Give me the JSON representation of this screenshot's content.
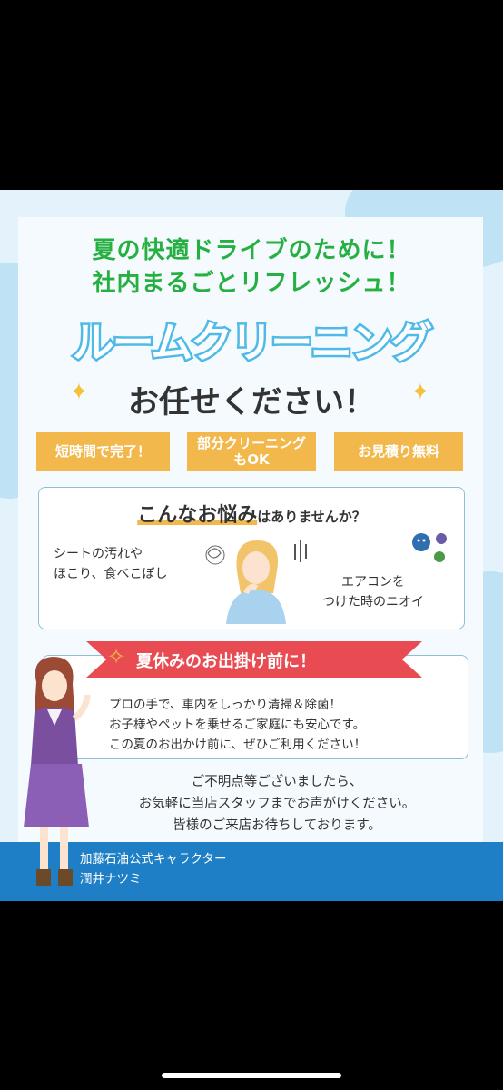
{
  "headline": {
    "line1": "夏の快適ドライブのために！",
    "line2": "社内まるごとリフレッシュ！"
  },
  "title": "ルームクリーニング",
  "subtitle": "お任せください！",
  "tags": [
    "短時間で完了！",
    "部分クリーニング\nもOK",
    "お見積り無料"
  ],
  "worry": {
    "heading_a": "こんなお悩み",
    "heading_b": "はありませんか？",
    "left_note": "シートの汚れや\nほこり、食べこぼし",
    "right_note": "エアコンを\nつけた時のニオイ"
  },
  "summer": {
    "ribbon": "夏休みのお出掛け前に！",
    "body": "プロの手で、車内をしっかり清掃＆除菌！\nお子様やペットを乗せるご家庭にも安心です。\nこの夏のお出かけ前に、ぜひご利用ください！"
  },
  "contact": "ご不明点等ございましたら、\nお気軽に当店スタッフまでお声がけください。\n皆様のご来店お待ちしております。",
  "character": {
    "line1": "加藤石油公式キャラクター",
    "line2": "潤井ナツミ"
  },
  "colors": {
    "green": "#27b042",
    "blue": "#4fb9e8",
    "orange": "#f2b84b",
    "red": "#e84c52",
    "band": "#1f7fc6"
  }
}
